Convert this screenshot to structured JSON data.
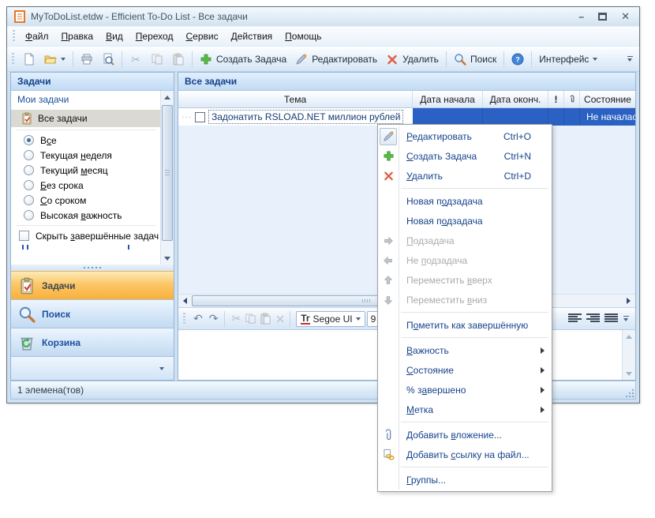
{
  "colors": {
    "selection_blue": "#2a61c2",
    "nav_orange": "#f9b13a",
    "header_text": "#15428b",
    "link_text": "#1e50a0"
  },
  "icons": {
    "minimize": "–",
    "close": "✕",
    "scissors": "✂",
    "undo": "↶",
    "redo": "↷",
    "font_tool": "Tr",
    "help": "?"
  },
  "window": {
    "title": "MyToDoList.etdw - Efficient To-Do List - Все задачи"
  },
  "menubar": {
    "items": [
      {
        "pre": "",
        "key": "Ф",
        "post": "айл"
      },
      {
        "pre": "",
        "key": "П",
        "post": "равка"
      },
      {
        "pre": "",
        "key": "В",
        "post": "ид"
      },
      {
        "pre": "",
        "key": "П",
        "post": "ереход"
      },
      {
        "pre": "",
        "key": "С",
        "post": "ервис"
      },
      {
        "pre": "",
        "key": "Д",
        "post": "ействия"
      },
      {
        "pre": "",
        "key": "П",
        "post": "омощь"
      }
    ]
  },
  "toolbar": {
    "create": "Создать Задача",
    "edit": "Редактировать",
    "delete": "Удалить",
    "search": "Поиск",
    "interface": "Интерфейс"
  },
  "sidebar": {
    "panel_header": "Задачи",
    "list_header": "Мои задачи",
    "all_tasks": "Все задачи",
    "radios": [
      {
        "pre": "В",
        "key": "с",
        "post": "е"
      },
      {
        "pre": "Текущая ",
        "key": "н",
        "post": "еделя"
      },
      {
        "pre": "Текущий ",
        "key": "м",
        "post": "есяц"
      },
      {
        "pre": "",
        "key": "Б",
        "post": "ез срока"
      },
      {
        "pre": "",
        "key": "С",
        "post": "о сроком"
      },
      {
        "pre": "Высокая ",
        "key": "в",
        "post": "ажность"
      }
    ],
    "hide_completed": {
      "pre": "Скрыть ",
      "key": "з",
      "post": "авершённые задач"
    },
    "nav": {
      "tasks": "Задачи",
      "search": "Поиск",
      "recycle": "Корзина"
    }
  },
  "main": {
    "header": "Все задачи",
    "table": {
      "col_subject": "Тема",
      "col_start": "Дата начала",
      "col_end": "Дата оконч.",
      "col_priority": "!"
    },
    "row": {
      "subject": "Задонатить RSLOAD.NET миллион рублей",
      "status": "Не началас"
    }
  },
  "editor": {
    "font_name": "Segoe UI",
    "font_size": "9"
  },
  "context_menu": {
    "items": [
      {
        "pre": "",
        "key": "Р",
        "post": "едактировать",
        "shortcut": "Ctrl+O"
      },
      {
        "pre": "",
        "key": "С",
        "post": "оздать Задача",
        "shortcut": "Ctrl+N"
      },
      {
        "pre": "",
        "key": "У",
        "post": "далить",
        "shortcut": "Ctrl+D"
      },
      {
        "pre": "Новая п",
        "key": "о",
        "post": "дзадача"
      },
      {
        "pre": "Новая п",
        "key": "о",
        "post": "дзадача"
      },
      {
        "pre": "",
        "key": "П",
        "post": "одзадача"
      },
      {
        "pre": "Не ",
        "key": "п",
        "post": "одзадача"
      },
      {
        "pre": "Переместить ",
        "key": "в",
        "post": "верх"
      },
      {
        "pre": "Переместить ",
        "key": "в",
        "post": "низ"
      },
      {
        "pre": "П",
        "key": "о",
        "post": "метить как завершённую"
      },
      {
        "pre": "",
        "key": "В",
        "post": "ажность"
      },
      {
        "pre": "",
        "key": "С",
        "post": "остояние"
      },
      {
        "pre": "% з",
        "key": "а",
        "post": "вершено"
      },
      {
        "pre": "",
        "key": "М",
        "post": "етка"
      },
      {
        "pre": "Добавить ",
        "key": "в",
        "post": "ложение..."
      },
      {
        "pre": "Добавить ",
        "key": "с",
        "post": "сылку на файл..."
      },
      {
        "pre": "",
        "key": "Г",
        "post": "руппы..."
      }
    ]
  },
  "status_bar": {
    "text": "1 элемена(тов)"
  }
}
